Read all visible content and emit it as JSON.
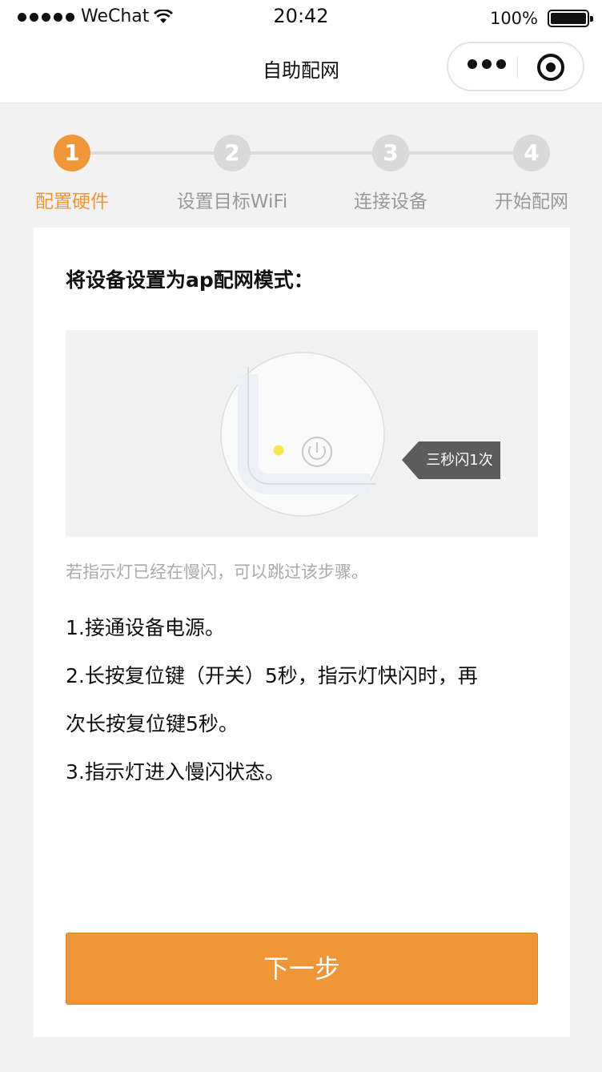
{
  "status_bar": {
    "carrier": "WeChat",
    "time": "20:42",
    "battery": "100%"
  },
  "nav": {
    "title": "自助配网"
  },
  "steps": [
    {
      "number": "1",
      "label": "配置硬件",
      "active": true
    },
    {
      "number": "2",
      "label": "设置目标WiFi",
      "active": false
    },
    {
      "number": "3",
      "label": "连接设备",
      "active": false
    },
    {
      "number": "4",
      "label": "开始配网",
      "active": false
    }
  ],
  "content": {
    "title": "将设备设置为ap配网模式：",
    "illustration_tag": "三秒闪1次",
    "hint": "若指示灯已经在慢闪，可以跳过该步骤。",
    "instructions": [
      "1.接通设备电源。",
      "2.长按复位键（开关）5秒，指示灯快闪时，再",
      "次长按复位键5秒。",
      "3.指示灯进入慢闪状态。"
    ],
    "next_button": "下一步"
  },
  "colors": {
    "accent": "#ee9638",
    "inactive": "#d9d9d9",
    "indicator_led": "#f5e84a"
  }
}
